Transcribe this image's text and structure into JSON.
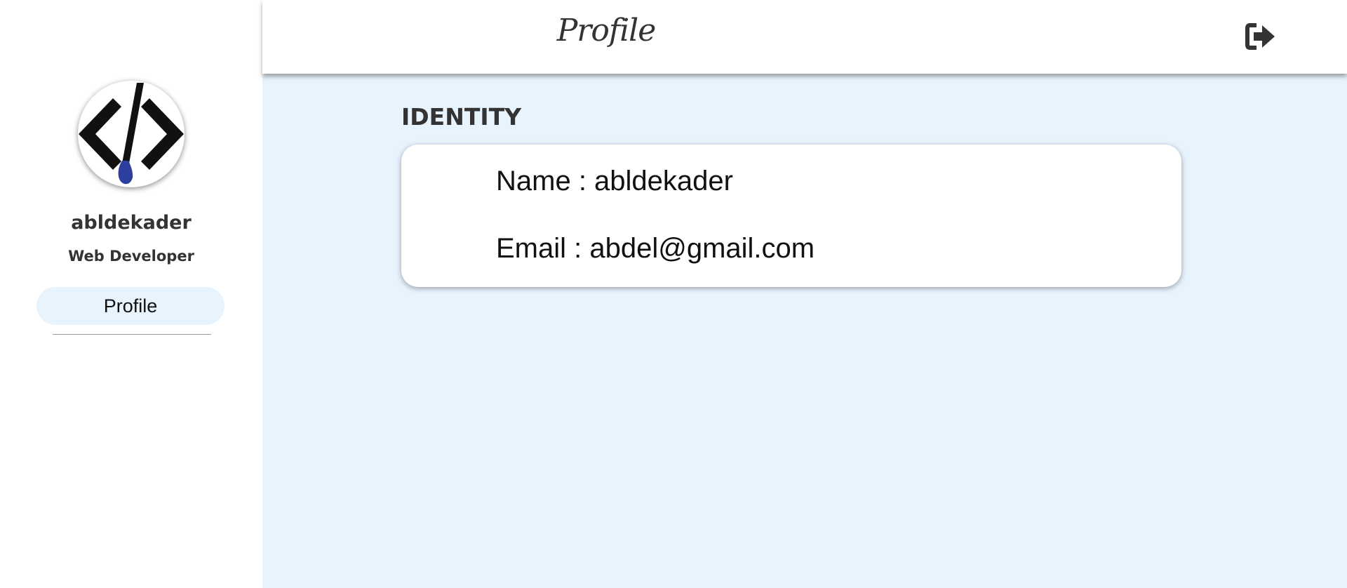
{
  "sidebar": {
    "avatar_icon": "code-brush-icon",
    "username": "abldekader",
    "role": "Web Developer",
    "nav": {
      "profile_label": "Profile"
    }
  },
  "header": {
    "title": "Profile",
    "logout_icon": "sign-out-icon"
  },
  "main": {
    "section_title": "IDENTITY",
    "identity": {
      "name_label": "Name",
      "name_value": "abldekader",
      "name_text": "Name : abldekader",
      "email_label": "Email",
      "email_value": "abdel@gmail.com",
      "email_text": "Email : abdel@gmail.com"
    }
  },
  "colors": {
    "main_background": "#e7f3fd",
    "nav_active_background": "#e7f3fd",
    "text_dark": "#333333",
    "brush_blue": "#2c3e9e"
  }
}
